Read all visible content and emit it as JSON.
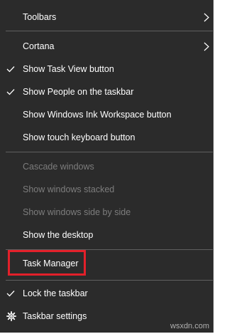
{
  "menu": {
    "items": [
      {
        "label": "Toolbars",
        "checked": false,
        "disabled": false,
        "submenu": true
      },
      {
        "label": "Cortana",
        "checked": false,
        "disabled": false,
        "submenu": true
      },
      {
        "label": "Show Task View button",
        "checked": true,
        "disabled": false
      },
      {
        "label": "Show People on the taskbar",
        "checked": true,
        "disabled": false
      },
      {
        "label": "Show Windows Ink Workspace button",
        "checked": false,
        "disabled": false
      },
      {
        "label": "Show touch keyboard button",
        "checked": false,
        "disabled": false
      },
      {
        "label": "Cascade windows",
        "checked": false,
        "disabled": true
      },
      {
        "label": "Show windows stacked",
        "checked": false,
        "disabled": true
      },
      {
        "label": "Show windows side by side",
        "checked": false,
        "disabled": true
      },
      {
        "label": "Show the desktop",
        "checked": false,
        "disabled": false
      },
      {
        "label": "Task Manager",
        "checked": false,
        "disabled": false,
        "highlighted": true
      },
      {
        "label": "Lock the taskbar",
        "checked": true,
        "disabled": false
      },
      {
        "label": "Taskbar settings",
        "icon": "gear-icon",
        "disabled": false
      }
    ]
  },
  "colors": {
    "background": "#2b2b2b",
    "text": "#ffffff",
    "disabled_text": "#7d7d7d",
    "separator": "#5f5f5f",
    "highlight_border": "#e3202a"
  },
  "watermark": "wsxdn.com"
}
